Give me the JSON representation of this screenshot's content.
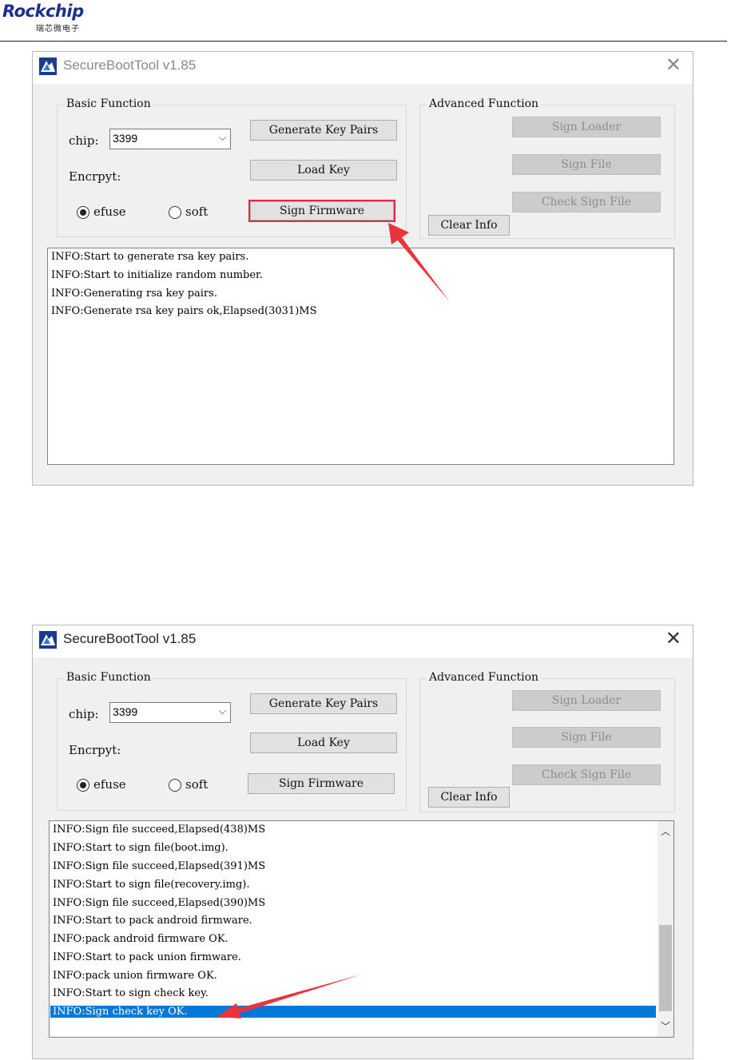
{
  "header": {
    "logo_text": "Rockchip",
    "logo_subtitle": "瑞芯微电子"
  },
  "windows": [
    {
      "title": "SecureBootTool v1.85",
      "basic_legend": "Basic Function",
      "chip_label": "chip:",
      "chip_value": "3399",
      "encrypt_label": "Encrpyt:",
      "radio_efuse": "efuse",
      "radio_soft": "soft",
      "selected_radio": "efuse",
      "btn_generate": "Generate Key Pairs",
      "btn_load": "Load Key",
      "btn_sign_firmware": "Sign Firmware",
      "advanced_legend": "Advanced Function",
      "btn_sign_loader": "Sign Loader",
      "btn_sign_file": "Sign File",
      "btn_check_sign": "Check Sign File",
      "btn_clear": "Clear Info",
      "log": [
        "INFO:Start to generate rsa key pairs.",
        "INFO:Start to initialize random number.",
        "INFO:Generating rsa key pairs.",
        "INFO:Generate rsa key pairs ok,Elapsed(3031)MS"
      ]
    },
    {
      "title": "SecureBootTool v1.85",
      "basic_legend": "Basic Function",
      "chip_label": "chip:",
      "chip_value": "3399",
      "encrypt_label": "Encrpyt:",
      "radio_efuse": "efuse",
      "radio_soft": "soft",
      "selected_radio": "efuse",
      "btn_generate": "Generate Key Pairs",
      "btn_load": "Load Key",
      "btn_sign_firmware": "Sign Firmware",
      "advanced_legend": "Advanced Function",
      "btn_sign_loader": "Sign Loader",
      "btn_sign_file": "Sign File",
      "btn_check_sign": "Check Sign File",
      "btn_clear": "Clear Info",
      "log": [
        "INFO:Sign file succeed,Elapsed(438)MS",
        "INFO:Start to sign file(boot.img).",
        "INFO:Sign file succeed,Elapsed(391)MS",
        "INFO:Start to sign file(recovery.img).",
        "INFO:Sign file succeed,Elapsed(390)MS",
        "INFO:Start to pack android firmware.",
        "INFO:pack android firmware OK.",
        "INFO:Start to pack union firmware.",
        "INFO:pack union firmware OK.",
        "INFO:Start to sign check key.",
        "INFO:Sign check key OK."
      ],
      "selected_log_line": "INFO:Sign check key OK."
    }
  ],
  "colors": {
    "annotation_arrow": "#e8343c",
    "selection": "#0078d7",
    "logo": "#1a2e8c"
  }
}
